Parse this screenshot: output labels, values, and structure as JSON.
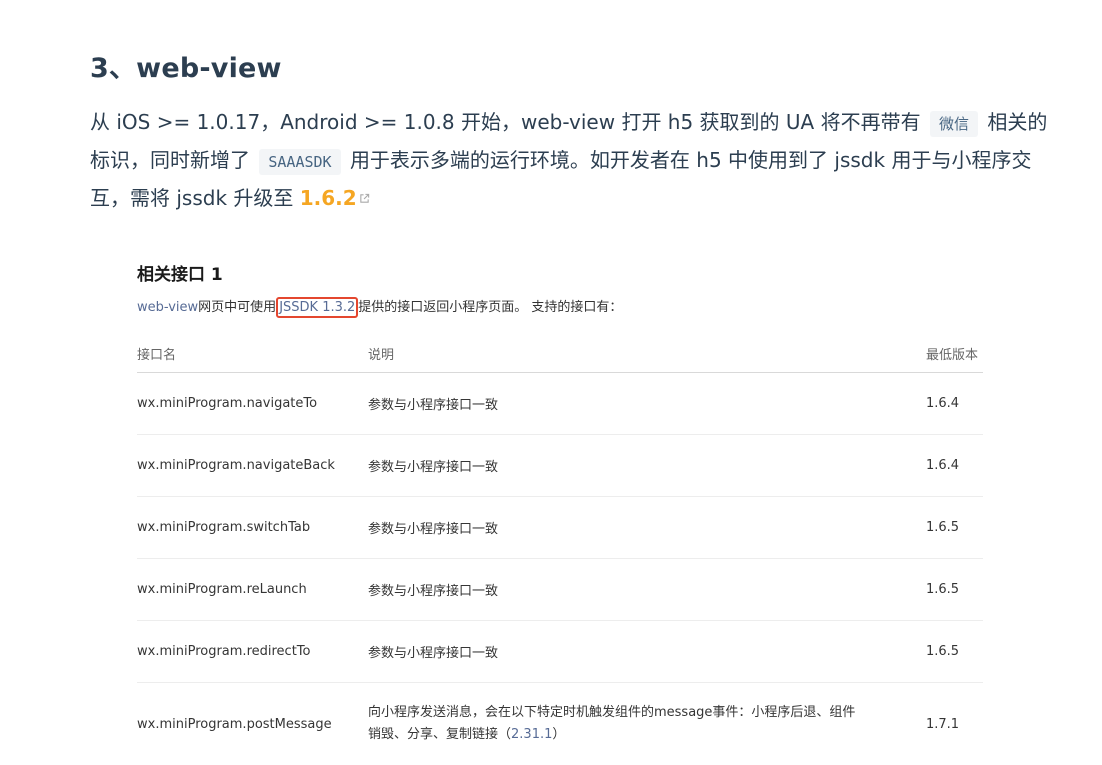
{
  "section": {
    "title": "3、web-view"
  },
  "paragraph": {
    "part1": "从 iOS >= 1.0.17，Android >= 1.0.8 开始，web-view 打开 h5 获取到的 UA 将不再带有",
    "code1": "微信",
    "part2": "相关的标识，同时新增了",
    "code2": "SAAASDK",
    "part3": "用于表示多端的运行环境。如开发者在 h5 中使用到了 jssdk 用于与小程序交互，需将 jssdk 升级至",
    "link_text": "1.6.2",
    "link_icon": "external-link-icon"
  },
  "colors": {
    "link_orange": "#f5a623",
    "table_link_blue": "#576b95",
    "highlight_red": "#e4472f"
  },
  "screenshot": {
    "title": "相关接口 1",
    "desc_prefix": "web-view",
    "desc_mid": "网页中可使用",
    "desc_boxed": "JSSDK 1.3.2",
    "desc_suffix": "提供的接口返回小程序页面。 支持的接口有：",
    "table": {
      "headers": [
        "接口名",
        "说明",
        "最低版本"
      ],
      "rows": [
        {
          "name": "wx.miniProgram.navigateTo",
          "desc": "参数与小程序接口一致",
          "version": "1.6.4"
        },
        {
          "name": "wx.miniProgram.navigateBack",
          "desc": "参数与小程序接口一致",
          "version": "1.6.4"
        },
        {
          "name": "wx.miniProgram.switchTab",
          "desc": "参数与小程序接口一致",
          "version": "1.6.5"
        },
        {
          "name": "wx.miniProgram.reLaunch",
          "desc": "参数与小程序接口一致",
          "version": "1.6.5"
        },
        {
          "name": "wx.miniProgram.redirectTo",
          "desc": "参数与小程序接口一致",
          "version": "1.6.5"
        },
        {
          "name": "wx.miniProgram.postMessage",
          "desc_line1": "向小程序发送消息，会在以下特定时机触发组件的message事件：小程序后退、组件",
          "desc_line2_text": "销毁、分享、复制链接（",
          "desc_line2_link": "2.31.1",
          "desc_line2_end": "）",
          "version": "1.7.1"
        }
      ]
    }
  }
}
